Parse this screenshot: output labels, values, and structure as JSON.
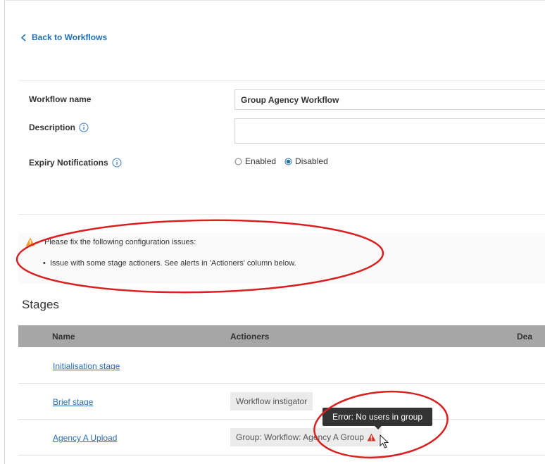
{
  "nav": {
    "back_label": "Back to Workflows"
  },
  "form": {
    "workflow_name_label": "Workflow name",
    "workflow_name_value": "Group Agency Workflow",
    "description_label": "Description",
    "description_value": "",
    "expiry_label": "Expiry Notifications",
    "expiry_options": [
      "Enabled",
      "Disabled"
    ],
    "expiry_selected": "Disabled"
  },
  "issues": {
    "heading": "Please fix the following configuration issues:",
    "items": [
      "Issue with some stage actioners. See alerts in 'Actioners' column below."
    ]
  },
  "stages": {
    "title": "Stages",
    "columns": [
      "Name",
      "Actioners",
      "Dea"
    ],
    "rows": [
      {
        "name": "Initialisation stage",
        "actioner": ""
      },
      {
        "name": "Brief stage",
        "actioner": "Workflow instigator"
      },
      {
        "name": "Agency A Upload",
        "actioner": "Group: Workflow: Agency A Group",
        "has_error": true
      }
    ]
  },
  "tooltip": {
    "text": "Error: No users in group"
  },
  "icons": {
    "back": "chevron-left-icon",
    "info": "info-circle-icon",
    "warning": "warning-triangle-icon",
    "error": "error-triangle-icon",
    "cursor": "mouse-pointer-icon"
  },
  "colors": {
    "link": "#1f6fb8",
    "warning": "#f0a030",
    "error": "#d9342b",
    "annotation": "#d92020",
    "table_header": "#a6a6a6",
    "tooltip_bg": "#333333",
    "radio_selected": "#1f6fb8"
  }
}
